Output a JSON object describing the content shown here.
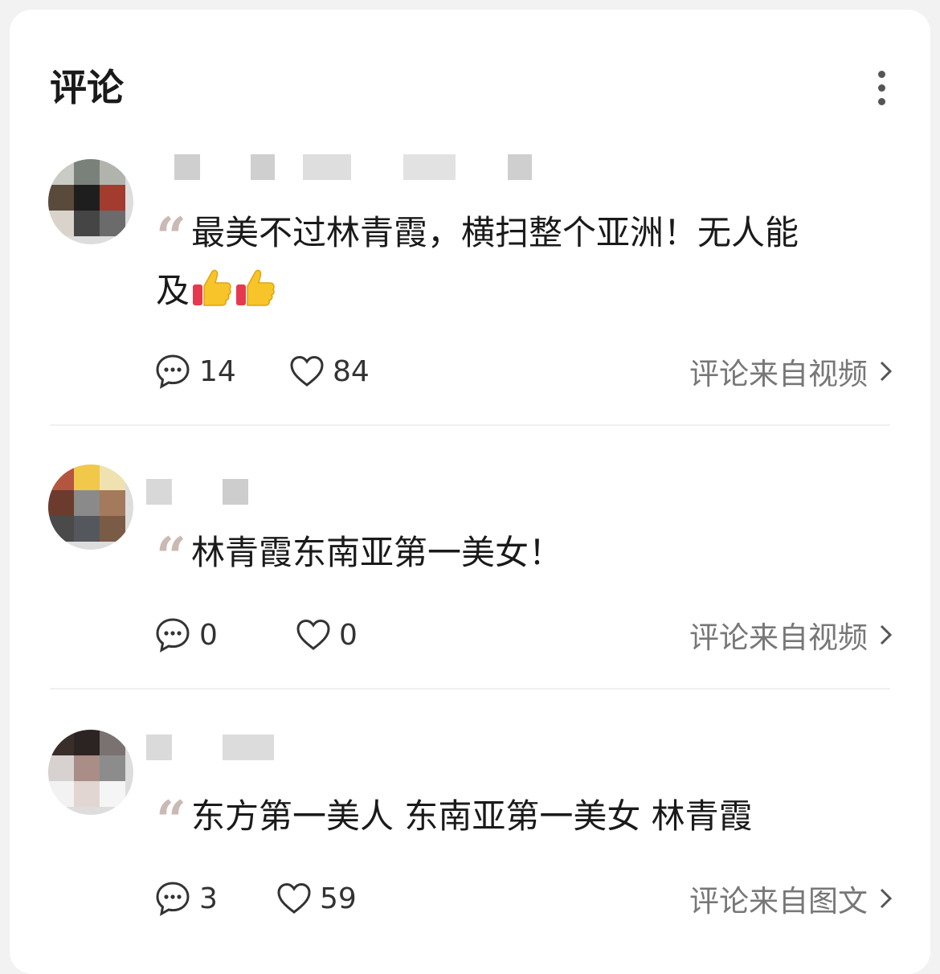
{
  "header": {
    "title": "评论",
    "more_icon": "more-vertical-icon"
  },
  "comments": [
    {
      "text": "最美不过林青霞，横扫整个亚洲！无人能",
      "text_line2": "及",
      "emoji": [
        "thumbs-up",
        "thumbs-up"
      ],
      "reply_count": "14",
      "like_count": "84",
      "source": "评论来自视频"
    },
    {
      "text": "林青霞东南亚第一美女！",
      "reply_count": "0",
      "like_count": "0",
      "source": "评论来自视频"
    },
    {
      "text": "东方第一美人 东南亚第一美女 林青霞",
      "reply_count": "3",
      "like_count": "59",
      "source": "评论来自图文"
    }
  ],
  "colors": {
    "quote_mark": "#cbb9b4",
    "source_text": "#777777",
    "thumb": "#f5c518"
  }
}
